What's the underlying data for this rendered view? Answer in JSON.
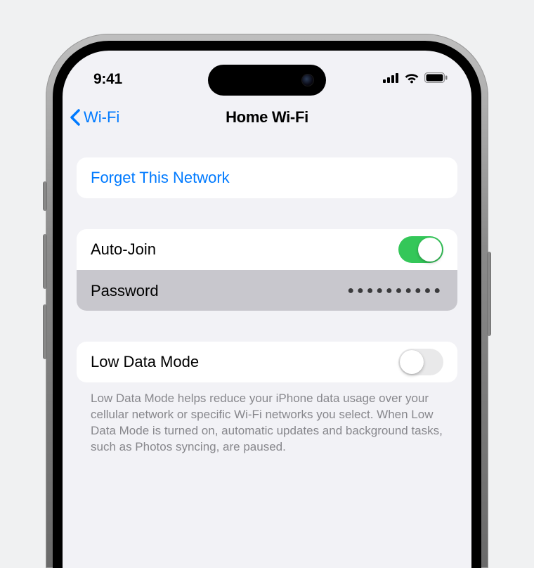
{
  "status": {
    "time": "9:41"
  },
  "nav": {
    "back_label": "Wi-Fi",
    "title": "Home Wi-Fi"
  },
  "sections": {
    "forget": {
      "label": "Forget This Network"
    },
    "autojoin": {
      "label": "Auto-Join",
      "value": true
    },
    "password": {
      "label": "Password",
      "masked": "●●●●●●●●●●"
    },
    "lowdata": {
      "label": "Low Data Mode",
      "value": false,
      "footer": "Low Data Mode helps reduce your iPhone data usage over your cellular network or specific Wi-Fi networks you select. When Low Data Mode is turned on, automatic updates and background tasks, such as Photos syncing, are paused."
    }
  },
  "colors": {
    "accent": "#007aff",
    "switch_on": "#34c759",
    "bg": "#f2f2f6"
  }
}
